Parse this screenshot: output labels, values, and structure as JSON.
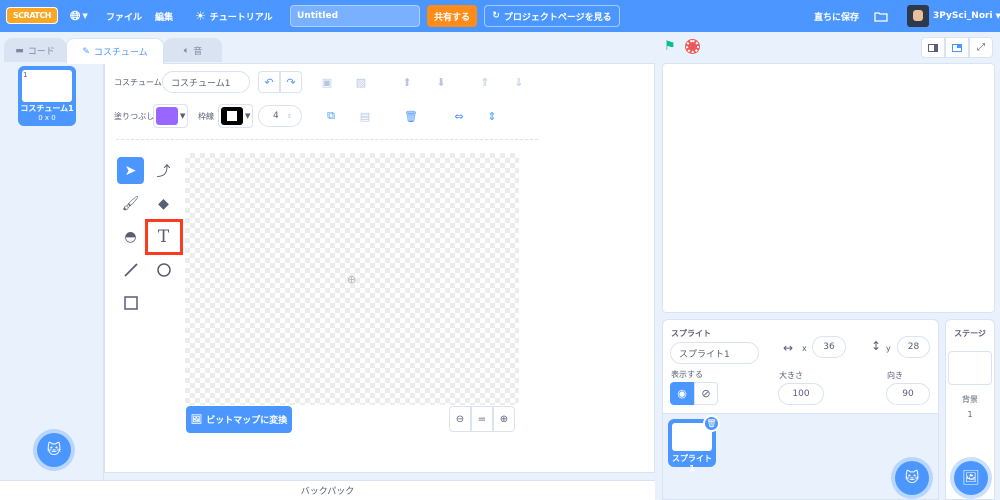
{
  "menubar": {
    "logo": "SCRATCH",
    "file": "ファイル",
    "edit": "編集",
    "tutorial": "チュートリアル",
    "project_title": "Untitled",
    "share": "共有する",
    "project_page": "プロジェクトページを見る",
    "save_now": "直ちに保存",
    "username": "3PySci_Nori"
  },
  "tabs": {
    "code": "コード",
    "costume": "コスチューム",
    "sound": "音"
  },
  "costume_list": [
    {
      "number": "1",
      "name": "コスチューム1",
      "size": "0 x 0"
    }
  ],
  "editor": {
    "costume_label": "コスチューム",
    "costume_name": "コスチューム1",
    "fill_label": "塗りつぶし",
    "outline_label": "枠線",
    "outline_width": "4",
    "fill_color": "#9966ff",
    "outline_color": "#000000",
    "convert_bitmap": "ビットマップに変換",
    "zoom_reset": "="
  },
  "backpack": "バックパック",
  "sprite_info": {
    "sprite_label": "スプライト",
    "sprite_name": "スプライト1",
    "x_label": "x",
    "x": "36",
    "y_label": "y",
    "y": "28",
    "show_label": "表示する",
    "size_label": "大きさ",
    "size": "100",
    "direction_label": "向き",
    "direction": "90"
  },
  "sprite_list": [
    {
      "name": "スプライト1"
    }
  ],
  "stage_pane": {
    "title": "ステージ",
    "backdrop_label": "背景",
    "backdrop_count": "1"
  },
  "colors": {
    "accent": "#4c97ff",
    "share": "#ff8c1a",
    "highlight": "#ff3b1f"
  }
}
